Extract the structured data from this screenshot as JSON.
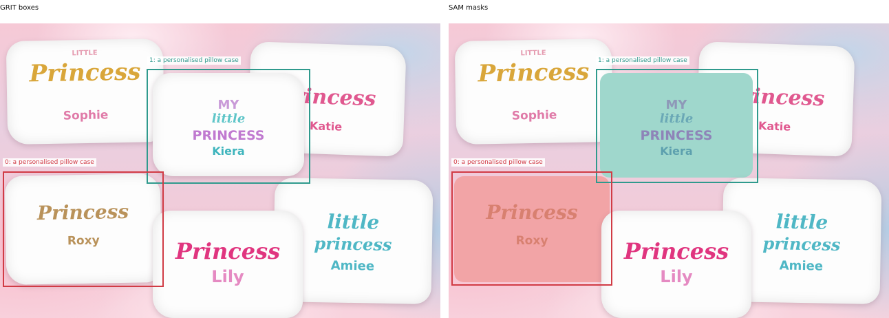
{
  "panels": {
    "left_title": "GRIT boxes",
    "right_title": "SAM masks"
  },
  "detections": [
    {
      "id": 0,
      "label": "0: a personalised pillow case",
      "color": "#d13b45"
    },
    {
      "id": 1,
      "label": "1: a personalised pillow case",
      "color": "#2f9a8d"
    }
  ],
  "mask_colors": {
    "0": "#f2a4a6",
    "1": "#9fd7cc"
  },
  "pillows": {
    "sophie": {
      "top": "LITTLE",
      "main": "Princess",
      "name": "Sophie"
    },
    "kiera": {
      "l1": "MY",
      "l2": "little",
      "l3": "PRINCESS",
      "name": "Kiera"
    },
    "katie": {
      "main": "Princess",
      "name": "Katie"
    },
    "roxy": {
      "main": "Princess",
      "name": "Roxy"
    },
    "lily": {
      "main": "Princess",
      "name": "Lily"
    },
    "amiee": {
      "l1": "little",
      "l2": "princess",
      "name": "Amiee"
    }
  }
}
